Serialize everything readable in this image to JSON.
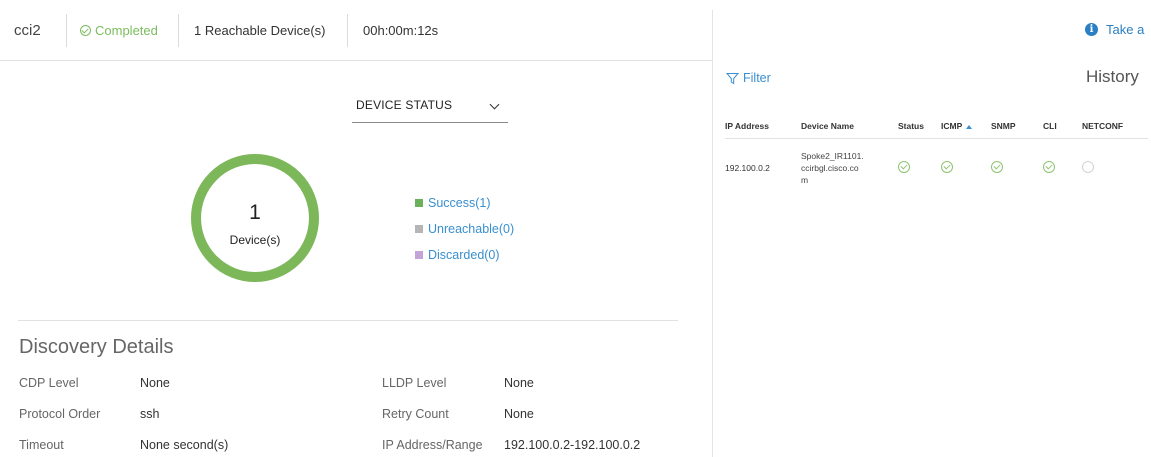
{
  "header": {
    "name": "cci2",
    "status": "Completed",
    "reachable": "1 Reachable Device(s)",
    "elapsed": "00h:00m:12s"
  },
  "dropdown": {
    "label": "DEVICE STATUS"
  },
  "donut": {
    "count": "1",
    "unit": "Device(s)",
    "success_fraction": 1.0,
    "color": "#7cb85a"
  },
  "legend": [
    {
      "label": "Success(1)",
      "color": "#6bb15a"
    },
    {
      "label": "Unreachable(0)",
      "color": "#b5b5b5"
    },
    {
      "label": "Discarded(0)",
      "color": "#c3a4d6"
    }
  ],
  "details": {
    "title": "Discovery Details",
    "left": [
      {
        "label": "CDP Level",
        "value": "None"
      },
      {
        "label": "Protocol Order",
        "value": "ssh"
      },
      {
        "label": "Timeout",
        "value": "None second(s)"
      }
    ],
    "right": [
      {
        "label": "LLDP Level",
        "value": "None"
      },
      {
        "label": "Retry Count",
        "value": "None"
      },
      {
        "label": "IP Address/Range",
        "value": "192.100.0.2-192.100.0.2"
      }
    ]
  },
  "panel": {
    "take_label": "Take a",
    "filter_label": "Filter",
    "history_label": "History",
    "columns": [
      "IP Address",
      "Device Name",
      "Status",
      "ICMP",
      "SNMP",
      "CLI",
      "NETCONF"
    ],
    "sorted_column": "ICMP",
    "rows": [
      {
        "ip": "192.100.0.2",
        "name_lines": [
          "Spoke2_IR1101.",
          "ccirbgl.cisco.co",
          "m"
        ],
        "status": "ok",
        "icmp": "ok",
        "snmp": "ok",
        "cli": "ok",
        "netconf": "none"
      }
    ]
  },
  "colors": {
    "accent": "#3a8fcf",
    "success": "#7bbc5f",
    "link": "#2b7fc4"
  }
}
